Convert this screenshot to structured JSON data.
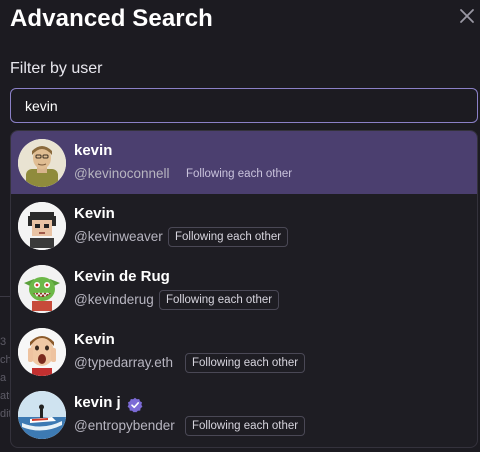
{
  "modal": {
    "title": "Advanced Search",
    "filter_label": "Filter by user",
    "close_icon": "close-icon"
  },
  "search": {
    "value": "kevin",
    "placeholder": ""
  },
  "background_fragments": [
    "3",
    "ch",
    "a",
    "atu",
    "dit"
  ],
  "results": [
    {
      "name": "kevin",
      "handle": "@kevinoconnell",
      "badge": "Following each other",
      "verified": false,
      "avatar": "cartoon-man-avatar",
      "active": true
    },
    {
      "name": "Kevin",
      "handle": "@kevinweaver",
      "badge": "Following each other",
      "verified": false,
      "avatar": "pixel-art-avatar",
      "active": false
    },
    {
      "name": "Kevin de Rug",
      "handle": "@kevinderug",
      "badge": "Following each other",
      "verified": false,
      "avatar": "green-goblin-avatar",
      "active": false
    },
    {
      "name": "Kevin",
      "handle": "@typedarray.eth",
      "badge": "Following each other",
      "verified": false,
      "avatar": "kid-photo-avatar",
      "active": false
    },
    {
      "name": "kevin j",
      "handle": "@entropybender",
      "badge": "Following each other",
      "verified": true,
      "avatar": "jetski-photo-avatar",
      "active": false
    }
  ],
  "colors": {
    "background": "#1c1b21",
    "active_row": "#4b3f6f",
    "input_border": "#8b80c7",
    "verified_badge": "#7c6bd6"
  }
}
